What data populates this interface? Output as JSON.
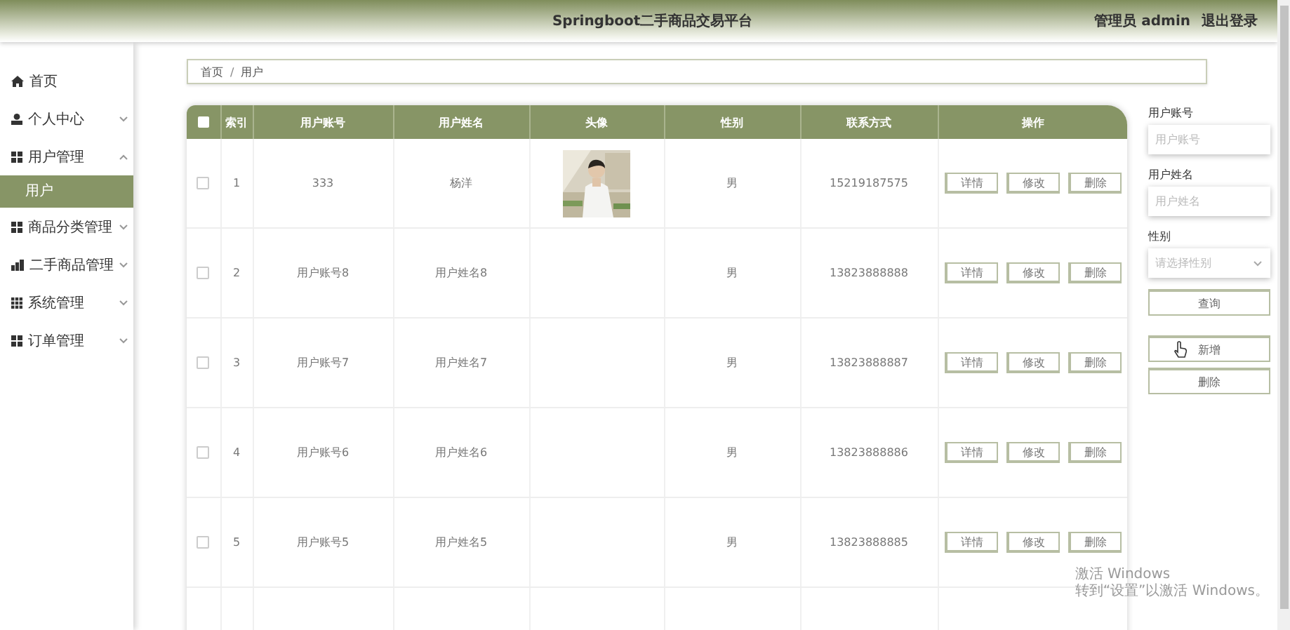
{
  "header": {
    "title": "Springboot二手商品交易平台",
    "user": "管理员 admin",
    "logout": "退出登录"
  },
  "sidebar": {
    "items": [
      {
        "label": "首页",
        "kind": "home"
      },
      {
        "label": "个人中心",
        "kind": "person",
        "expanded": false
      },
      {
        "label": "用户管理",
        "kind": "grid",
        "expanded": true,
        "children": [
          {
            "label": "用户",
            "selected": true
          }
        ]
      },
      {
        "label": "商品分类管理",
        "kind": "grid",
        "expanded": false
      },
      {
        "label": "二手商品管理",
        "kind": "chart",
        "expanded": false
      },
      {
        "label": "系统管理",
        "kind": "grid9",
        "expanded": false
      },
      {
        "label": "订单管理",
        "kind": "grid",
        "expanded": false
      }
    ]
  },
  "breadcrumb": {
    "items": [
      "首页",
      "用户"
    ],
    "separator": "/"
  },
  "table": {
    "select_all_checked": false,
    "columns": [
      "索引",
      "用户账号",
      "用户姓名",
      "头像",
      "性别",
      "联系方式",
      "操作"
    ],
    "rows": [
      {
        "checked": false,
        "index": "1",
        "account": "333",
        "name": "杨洋",
        "gender": "男",
        "phone": "15219187575",
        "actions": [
          "详情",
          "修改",
          "删除"
        ]
      },
      {
        "checked": false,
        "index": "2",
        "account": "用户账号8",
        "name": "用户姓名8",
        "gender": "男",
        "phone": "13823888888",
        "actions": [
          "详情",
          "修改",
          "删除"
        ]
      },
      {
        "checked": false,
        "index": "3",
        "account": "用户账号7",
        "name": "用户姓名7",
        "gender": "男",
        "phone": "13823888887",
        "actions": [
          "详情",
          "修改",
          "删除"
        ]
      },
      {
        "checked": false,
        "index": "4",
        "account": "用户账号6",
        "name": "用户姓名6",
        "gender": "男",
        "phone": "13823888886",
        "actions": [
          "详情",
          "修改",
          "删除"
        ]
      },
      {
        "checked": false,
        "index": "5",
        "account": "用户账号5",
        "name": "用户姓名5",
        "gender": "男",
        "phone": "13823888885",
        "actions": [
          "详情",
          "修改",
          "删除"
        ]
      }
    ]
  },
  "search": {
    "fields": [
      {
        "label": "用户账号",
        "placeholder": "用户账号"
      },
      {
        "label": "用户姓名",
        "placeholder": "用户姓名"
      }
    ],
    "select": {
      "label": "性别",
      "placeholder": "请选择性别"
    },
    "query_button": "查询",
    "add_button": "新增",
    "delete_button": "删除"
  },
  "windows_notice": {
    "title": "激活 Windows",
    "hint": "转到“设置”以激活 Windows。"
  }
}
